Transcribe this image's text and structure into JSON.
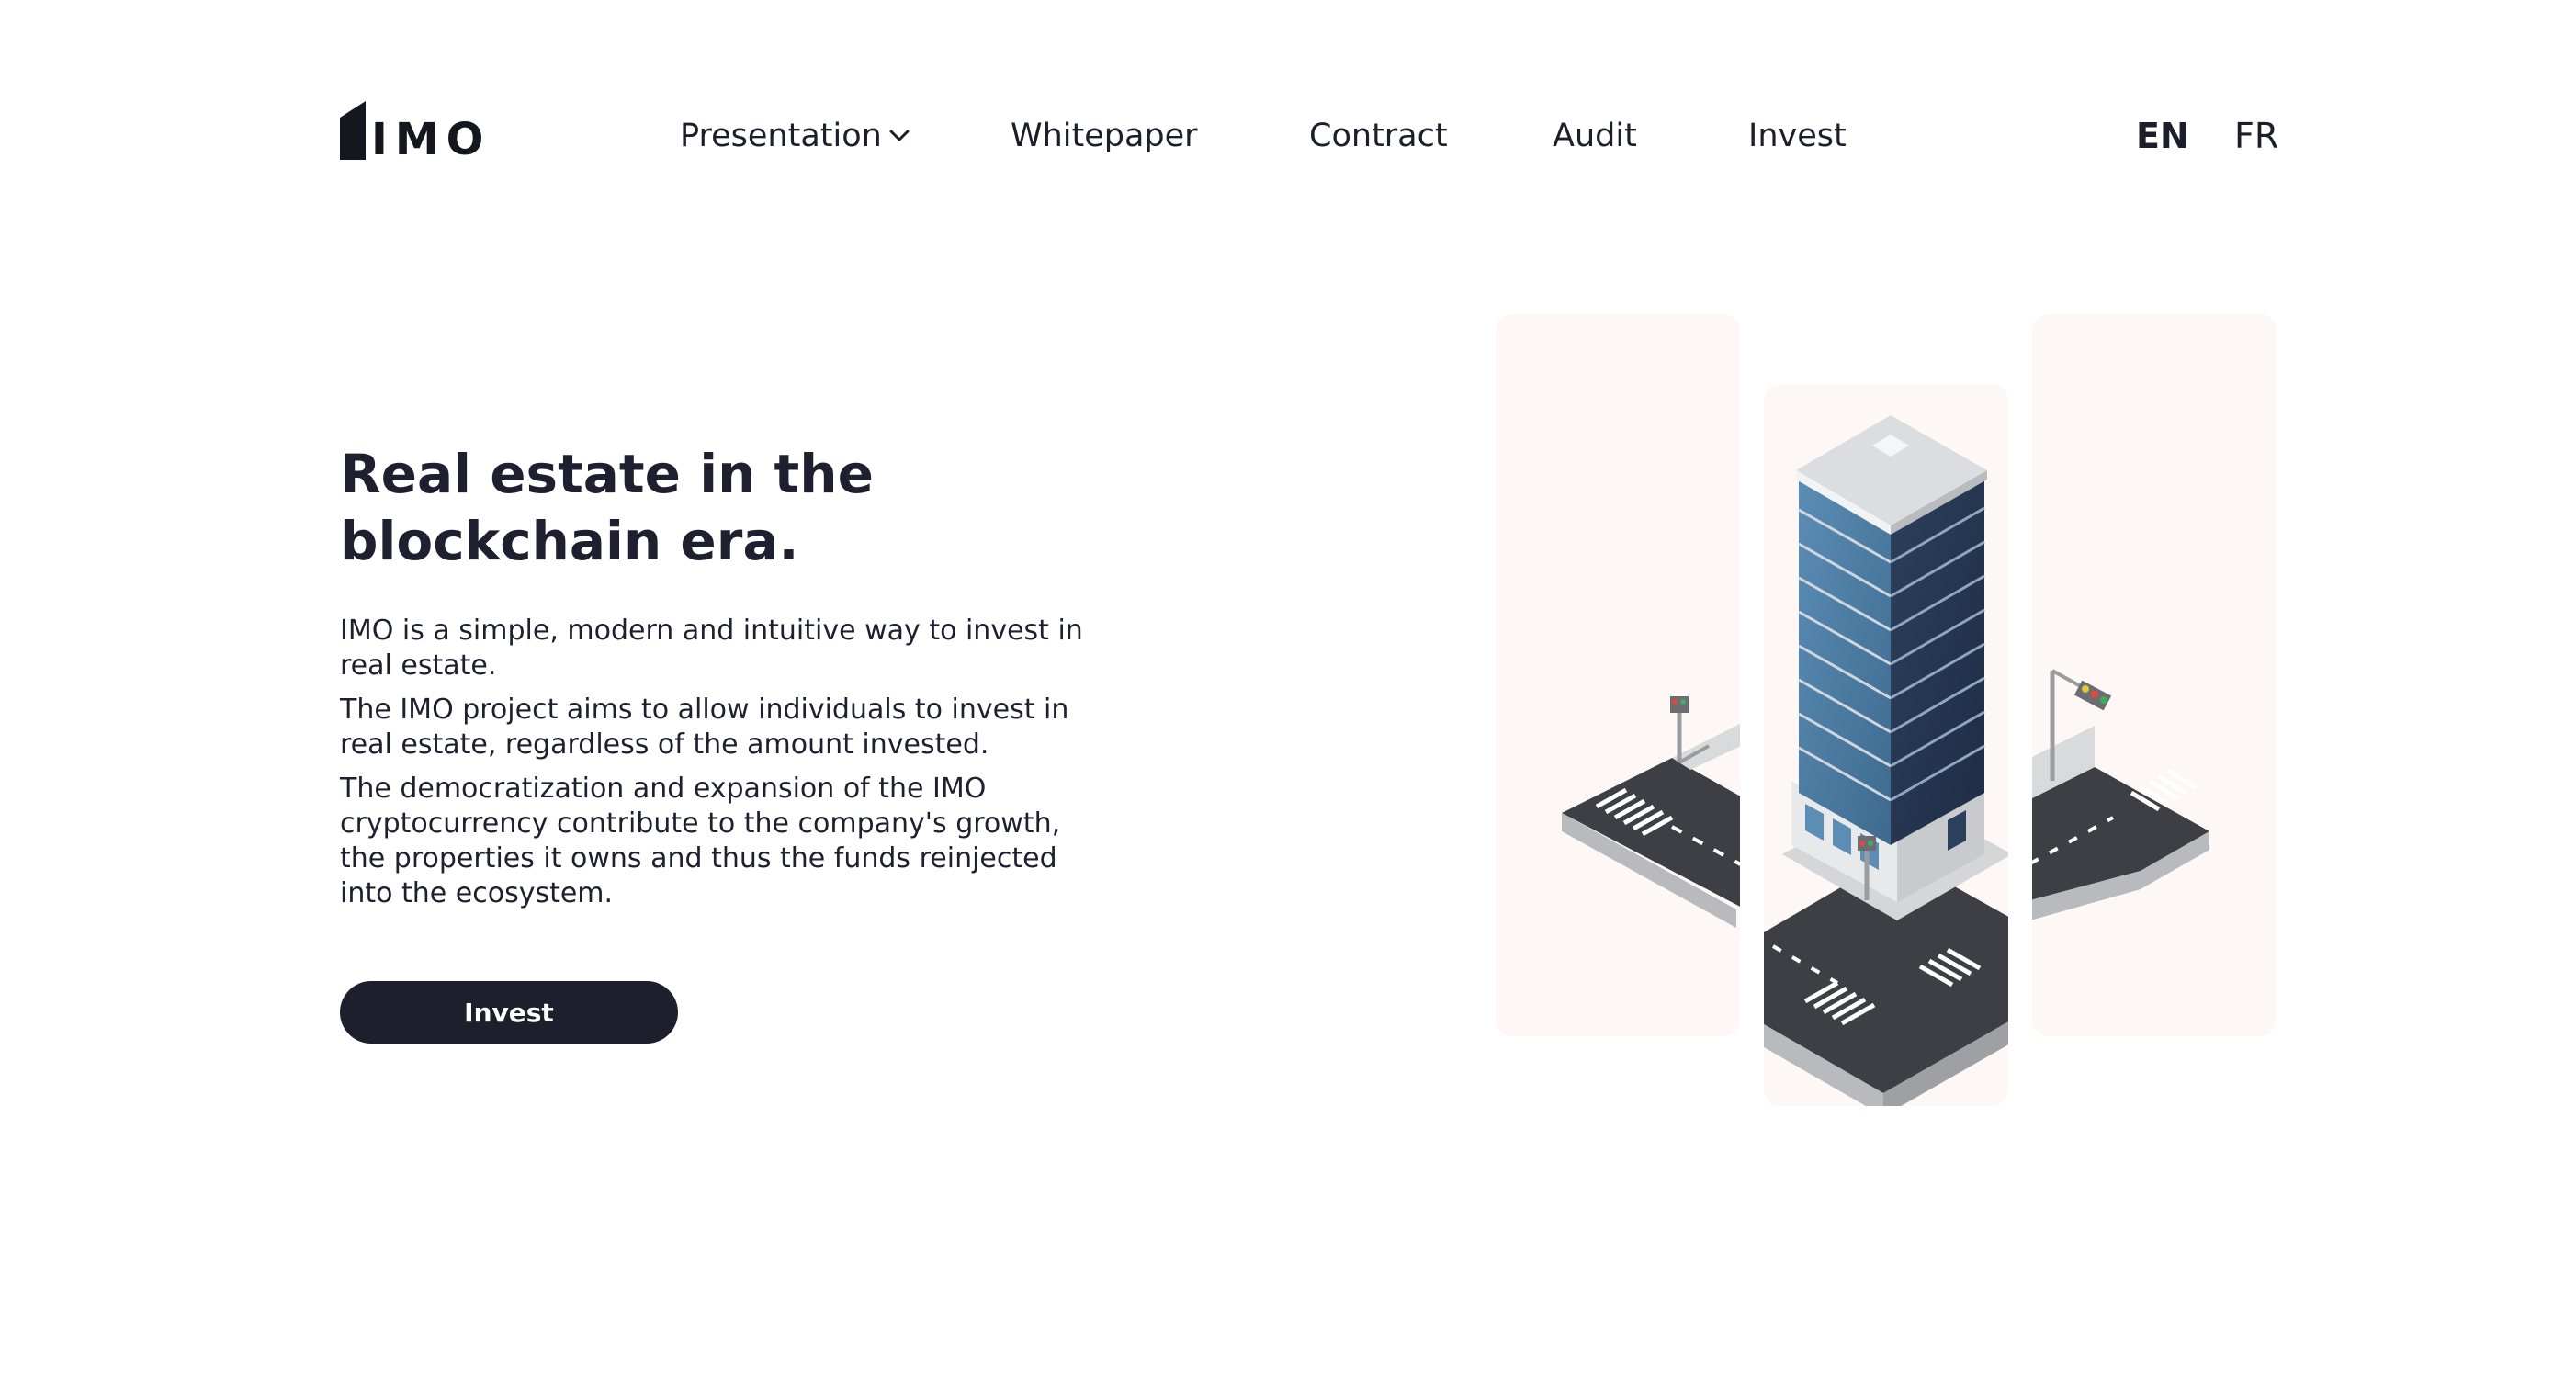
{
  "header": {
    "logo_text": "IMO",
    "nav": [
      {
        "label": "Presentation",
        "has_dropdown": true
      },
      {
        "label": "Whitepaper"
      },
      {
        "label": "Contract"
      },
      {
        "label": "Audit"
      },
      {
        "label": "Invest"
      }
    ],
    "languages": [
      {
        "label": "EN",
        "active": true
      },
      {
        "label": "FR",
        "active": false
      }
    ]
  },
  "hero": {
    "title_line1": "Real estate in the",
    "title_line2": "blockchain era.",
    "paragraphs": [
      "IMO is a simple, modern and intuitive way to invest in real estate.",
      "The IMO project aims to allow individuals to invest in real estate, regardless of the amount invested.",
      "The democratization and expansion of the IMO cryptocurrency contribute to the company's growth, the properties it owns and thus the funds reinjected into the ecosystem."
    ],
    "cta_label": "Invest"
  },
  "colors": {
    "text": "#1c1e2a",
    "button_bg": "#1d202c",
    "button_text": "#ffffff",
    "panel_bg": "#fdf8f5",
    "building_glass": "#4f7fa6",
    "road": "#3d3f44"
  }
}
